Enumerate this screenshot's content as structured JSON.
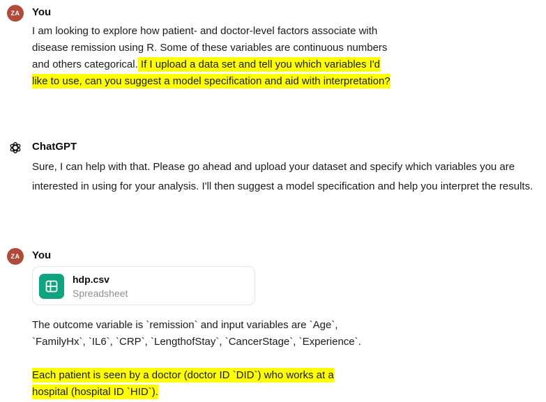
{
  "messages": [
    {
      "avatar": "ZA",
      "author": "You",
      "text_plain": "I am looking to explore how patient- and doctor-level factors associate with disease remission using R. Some of these variables are continuous numbers and others categorical.",
      "text_highlight": " If I upload a data set and tell you which variables I'd like to use, can you suggest a model specification and aid with interpretation?"
    },
    {
      "avatar_icon": "chatgpt-logo-icon",
      "author": "ChatGPT",
      "text": "Sure, I can help with that. Please go ahead and upload your dataset and specify which variables you are interested in using for your analysis. I'll then suggest a model specification and help you interpret the results."
    },
    {
      "avatar": "ZA",
      "author": "You",
      "attachment": {
        "name": "hdp.csv",
        "type": "Spreadsheet",
        "icon": "spreadsheet-icon"
      },
      "text": "The outcome variable is `remission` and input variables are `Age`, `FamilyHx`, `IL6`, `CRP`, `LengthofStay`, `CancerStage`, `Experience`.",
      "text_highlight": "Each patient is seen by a doctor (doctor ID `DID`) who works at a hospital (hospital ID `HID`)."
    }
  ],
  "colors": {
    "avatar": "#b04a3a",
    "highlight": "#ffff00",
    "file_icon_bg": "#10a37f"
  }
}
